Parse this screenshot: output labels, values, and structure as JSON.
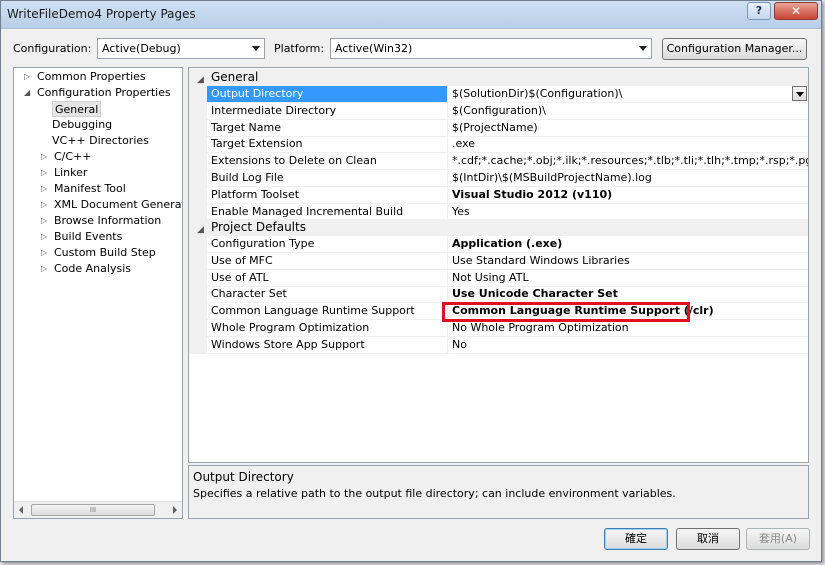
{
  "window": {
    "title": "WriteFileDemo4 Property Pages",
    "help_label": "?",
    "close_label": "✕"
  },
  "config": {
    "configuration_label": "Configuration:",
    "configuration_value": "Active(Debug)",
    "platform_label": "Platform:",
    "platform_value": "Active(Win32)",
    "manager_label": "Configuration Manager..."
  },
  "tree": {
    "items": [
      {
        "label": "Common Properties",
        "expander": "▷"
      },
      {
        "label": "Configuration Properties",
        "expander": "◢"
      },
      {
        "label": "General",
        "expander": ""
      },
      {
        "label": "Debugging",
        "expander": ""
      },
      {
        "label": "VC++ Directories",
        "expander": ""
      },
      {
        "label": "C/C++",
        "expander": "▷"
      },
      {
        "label": "Linker",
        "expander": "▷"
      },
      {
        "label": "Manifest Tool",
        "expander": "▷"
      },
      {
        "label": "XML Document Generator",
        "expander": "▷"
      },
      {
        "label": "Browse Information",
        "expander": "▷"
      },
      {
        "label": "Build Events",
        "expander": "▷"
      },
      {
        "label": "Custom Build Step",
        "expander": "▷"
      },
      {
        "label": "Code Analysis",
        "expander": "▷"
      }
    ],
    "scroll_thumb": "III"
  },
  "grid": {
    "general_label": "General",
    "defaults_label": "Project Defaults",
    "general": [
      {
        "name": "Output Directory",
        "value": "$(SolutionDir)$(Configuration)\\"
      },
      {
        "name": "Intermediate Directory",
        "value": "$(Configuration)\\"
      },
      {
        "name": "Target Name",
        "value": "$(ProjectName)"
      },
      {
        "name": "Target Extension",
        "value": ".exe"
      },
      {
        "name": "Extensions to Delete on Clean",
        "value": "*.cdf;*.cache;*.obj;*.ilk;*.resources;*.tlb;*.tli;*.tlh;*.tmp;*.rsp;*.pgc;*.pgd;*.m"
      },
      {
        "name": "Build Log File",
        "value": "$(IntDir)\\$(MSBuildProjectName).log"
      },
      {
        "name": "Platform Toolset",
        "value": "Visual Studio 2012 (v110)"
      },
      {
        "name": "Enable Managed Incremental Build",
        "value": "Yes"
      }
    ],
    "defaults": [
      {
        "name": "Configuration Type",
        "value": "Application (.exe)"
      },
      {
        "name": "Use of MFC",
        "value": "Use Standard Windows Libraries"
      },
      {
        "name": "Use of ATL",
        "value": "Not Using ATL"
      },
      {
        "name": "Character Set",
        "value": "Use Unicode Character Set"
      },
      {
        "name": "Common Language Runtime Support",
        "value": "Common Language Runtime Support (/clr)"
      },
      {
        "name": "Whole Program Optimization",
        "value": "No Whole Program Optimization"
      },
      {
        "name": "Windows Store App Support",
        "value": "No"
      }
    ]
  },
  "description": {
    "title": "Output Directory",
    "text": "Specifies a relative path to the output file directory; can include environment variables."
  },
  "buttons": {
    "ok": "確定",
    "cancel": "取消",
    "apply": "套用(A)"
  },
  "colors": {
    "selection": "#3399ff",
    "highlight_box": "#e01020"
  }
}
